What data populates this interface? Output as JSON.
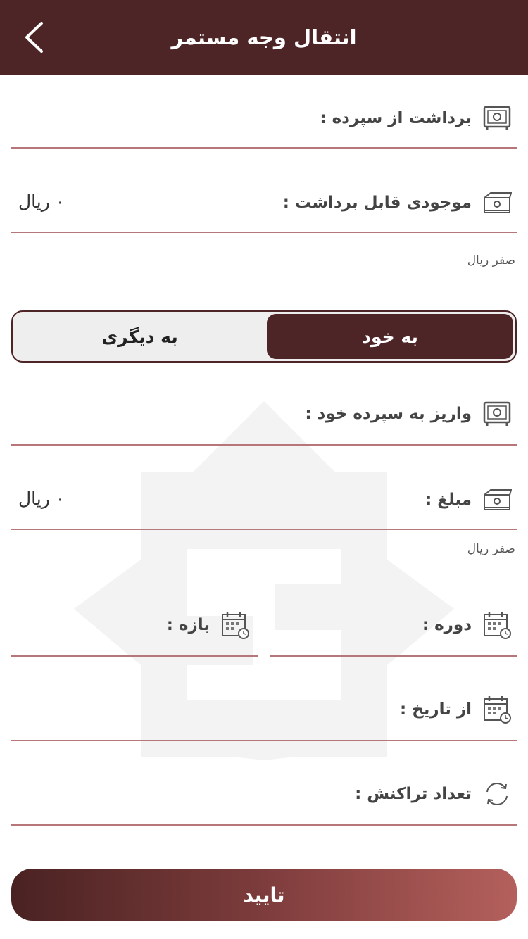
{
  "header": {
    "title": "انتقال وجه مستمر"
  },
  "withdraw": {
    "label": "برداشت از سپرده :"
  },
  "balance": {
    "label": "موجودی قابل برداشت :",
    "value": "۰ ریال",
    "hint": "صفر ریال"
  },
  "segment": {
    "active_label": "به خود",
    "inactive_label": "به دیگری"
  },
  "deposit": {
    "label": "واریز به سپرده خود :"
  },
  "amount": {
    "label": "مبلغ :",
    "value": "۰ ریال",
    "hint": "صفر ریال"
  },
  "period": {
    "label": "دوره :"
  },
  "interval": {
    "label": "بازه :"
  },
  "from_date": {
    "label": "از تاریخ :"
  },
  "tx_count": {
    "label": "تعداد تراکنش :"
  },
  "submit": {
    "label": "تایید"
  },
  "colors": {
    "primary": "#4e2526",
    "line": "#b7777a",
    "accent_end": "#b4605c"
  },
  "icons": [
    "back-chevron",
    "safe-icon",
    "money-icon",
    "calendar-icon",
    "refresh-icon"
  ]
}
